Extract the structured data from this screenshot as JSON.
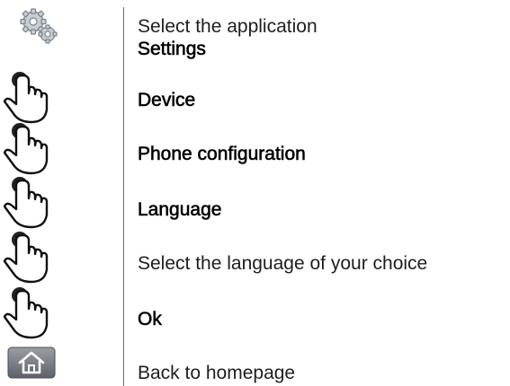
{
  "steps": [
    {
      "icon": "gear-icon",
      "line1": "Select the application",
      "line2": "Settings"
    },
    {
      "icon": "hand-tap-icon",
      "label": "Device"
    },
    {
      "icon": "hand-tap-icon",
      "label": "Phone configuration"
    },
    {
      "icon": "hand-tap-icon",
      "label": "Language"
    },
    {
      "icon": "hand-tap-icon",
      "label": "Select the language of your choice"
    },
    {
      "icon": "hand-tap-icon",
      "label": "Ok"
    },
    {
      "icon": "home-icon",
      "label": "Back to homepage"
    }
  ]
}
